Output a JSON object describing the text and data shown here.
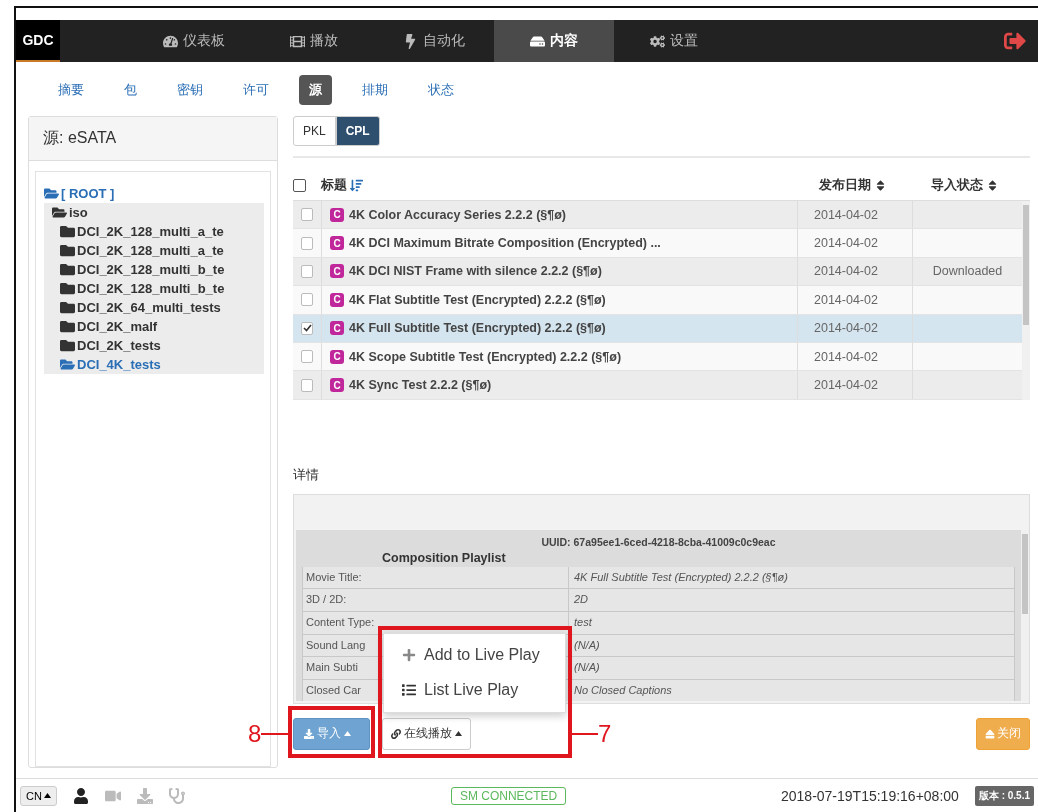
{
  "nav": {
    "logo": "GDC",
    "items": [
      {
        "label": "仪表板",
        "kind": "gauge",
        "selected": false
      },
      {
        "label": "播放",
        "kind": "film",
        "selected": false
      },
      {
        "label": "自动化",
        "kind": "bolt",
        "selected": false
      },
      {
        "label": "内容",
        "kind": "drive",
        "selected": true
      },
      {
        "label": "设置",
        "kind": "gears",
        "selected": false
      }
    ]
  },
  "subtabs": [
    {
      "label": "摘要",
      "selected": false
    },
    {
      "label": "包",
      "selected": false
    },
    {
      "label": "密钥",
      "selected": false
    },
    {
      "label": "许可",
      "selected": false
    },
    {
      "label": "源",
      "selected": true
    },
    {
      "label": "排期",
      "selected": false
    },
    {
      "label": "状态",
      "selected": false
    }
  ],
  "source_panel": {
    "title": "源: eSATA",
    "tree": [
      {
        "label": "[ ROOT ]",
        "expanded": true,
        "children": [
          {
            "label": "iso",
            "expanded": true,
            "selected": false,
            "children": [
              {
                "label": "DCI_2K_128_multi_a_te",
                "expanded": false,
                "selected": false
              },
              {
                "label": "DCI_2K_128_multi_a_te",
                "expanded": false,
                "selected": false
              },
              {
                "label": "DCI_2K_128_multi_b_te",
                "expanded": false,
                "selected": false
              },
              {
                "label": "DCI_2K_128_multi_b_te",
                "expanded": false,
                "selected": false
              },
              {
                "label": "DCI_2K_64_multi_tests",
                "expanded": false,
                "selected": false
              },
              {
                "label": "DCI_2K_malf",
                "expanded": false,
                "selected": false
              },
              {
                "label": "DCI_2K_tests",
                "expanded": false,
                "selected": false
              },
              {
                "label": "DCI_4K_tests",
                "expanded": true,
                "selected": true
              }
            ]
          }
        ]
      }
    ]
  },
  "format_tabs": [
    {
      "label": "PKL",
      "selected": false
    },
    {
      "label": "CPL",
      "selected": true
    }
  ],
  "table": {
    "select_all": {
      "checked": false
    },
    "columns": [
      {
        "label": "标题",
        "sorted": true
      },
      {
        "label": "发布日期",
        "sorted": false
      },
      {
        "label": "导入状态",
        "sorted": false
      }
    ],
    "rows": [
      {
        "badge": "C",
        "title": "4K Color Accuracy Series 2.2.2 (§¶ø)",
        "date": "2014-04-02",
        "checked": false,
        "selected": false
      },
      {
        "badge": "C",
        "title": "4K DCI Maximum Bitrate Composition (Encrypted) ...",
        "date": "2014-04-02",
        "checked": false,
        "selected": false
      },
      {
        "badge": "C",
        "title": "4K DCI NIST Frame with silence 2.2.2 (§¶ø)",
        "date": "2014-04-02",
        "status": "Downloaded",
        "checked": false,
        "selected": false
      },
      {
        "badge": "C",
        "title": "4K Flat Subtitle Test (Encrypted) 2.2.2 (§¶ø)",
        "date": "2014-04-02",
        "checked": false,
        "selected": false
      },
      {
        "badge": "C",
        "title": "4K Full Subtitle Test (Encrypted) 2.2.2 (§¶ø)",
        "date": "2014-04-02",
        "checked": true,
        "selected": true
      },
      {
        "badge": "C",
        "title": "4K Scope Subtitle Test (Encrypted) 2.2.2 (§¶ø)",
        "date": "2014-04-02",
        "checked": false,
        "selected": false
      },
      {
        "badge": "C",
        "title": "4K Sync Test 2.2.2 (§¶ø)",
        "date": "2014-04-02",
        "checked": false,
        "selected": false
      }
    ]
  },
  "details": {
    "label": "详情",
    "uuid": "UUID: 67a95ee1-6ced-4218-8cba-41009c0c9eac",
    "heading": "Composition Playlist",
    "fields": [
      {
        "label": "Movie Title:",
        "value": "4K Full Subtitle Test (Encrypted) 2.2.2 (§¶ø)"
      },
      {
        "label": "3D / 2D:",
        "value": "2D"
      },
      {
        "label": "Content Type:",
        "value": "test"
      },
      {
        "label": "Sound Lang",
        "value": "(N/A)"
      },
      {
        "label": "Main Subti",
        "value": "(N/A)"
      },
      {
        "label": "Closed Car",
        "value": "No Closed Captions"
      }
    ]
  },
  "menu": {
    "items": [
      {
        "label": "Add to Live Play",
        "kind": "plus"
      },
      {
        "label": "List Live Play",
        "kind": "list"
      }
    ]
  },
  "buttons": {
    "import": "导入",
    "live_play": "在线播放",
    "close": "关闭"
  },
  "annotations": [
    {
      "number": "8"
    },
    {
      "number": "7"
    }
  ],
  "status_bar": {
    "language": "CN",
    "connection": "SM CONNECTED",
    "datetime": "2018-07-19T15:19:16+08:00",
    "version": "版本 : 0.5.1"
  }
}
